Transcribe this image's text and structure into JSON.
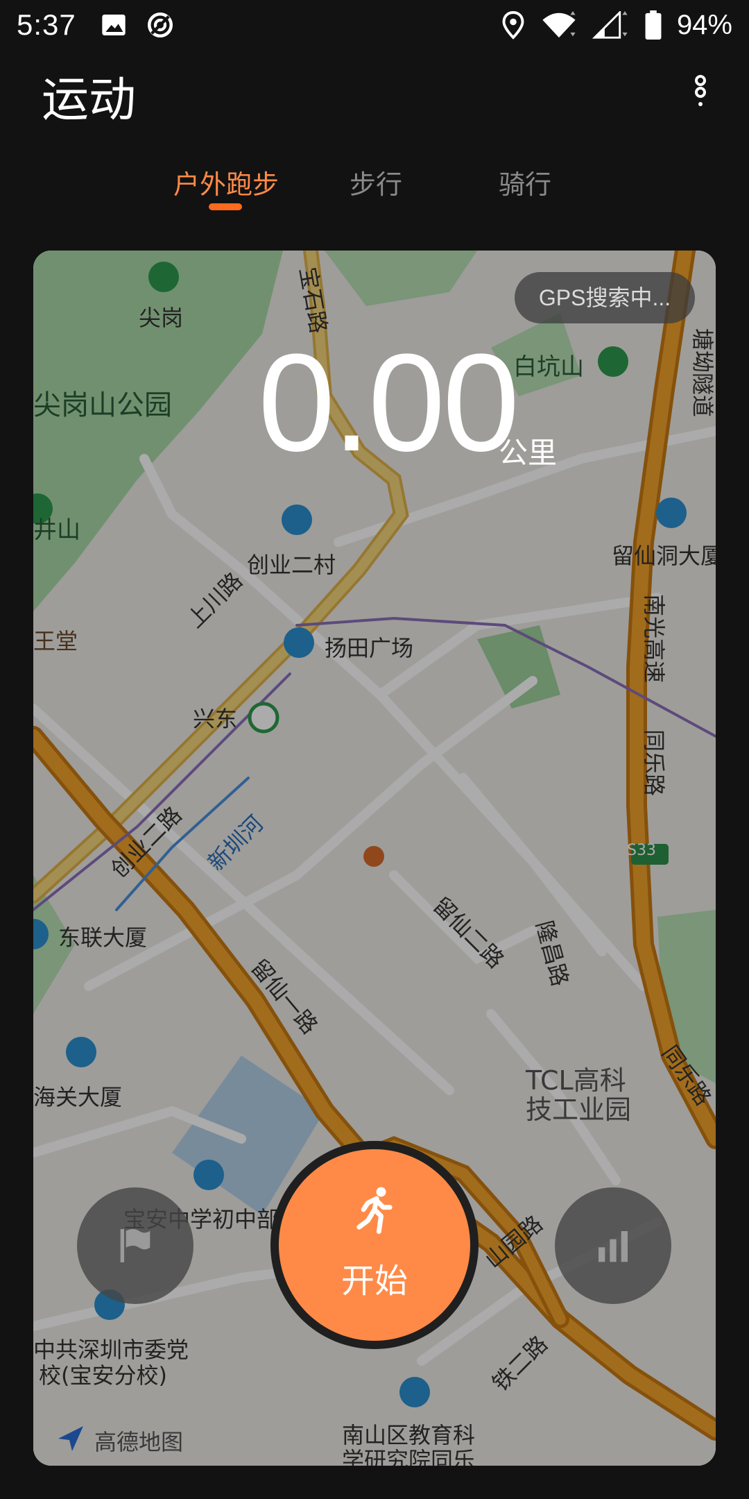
{
  "status_bar": {
    "time": "5:37",
    "battery": "94%",
    "icons": [
      "image-icon",
      "data-saver-icon",
      "location-icon",
      "wifi-icon",
      "signal-icon",
      "battery-icon"
    ]
  },
  "app_bar": {
    "title": "运动",
    "more_icon": "more-vert-icon"
  },
  "tabs": [
    {
      "label": "户外跑步",
      "active": true
    },
    {
      "label": "步行",
      "active": false
    },
    {
      "label": "骑行",
      "active": false
    }
  ],
  "colors": {
    "accent": "#ff8a47",
    "indicator": "#ff6a1e",
    "background": "#121212"
  },
  "workout": {
    "gps_status": "GPS搜索中...",
    "distance": "0.00",
    "distance_unit": "公里",
    "start_label": "开始",
    "flag_icon": "flag-icon",
    "stats_icon": "bar-chart-icon",
    "start_icon": "runner-icon"
  },
  "map": {
    "brand": "高德地图",
    "labels": [
      "尖岗",
      "尖岗山公园",
      "宝石路",
      "白坑山",
      "塘坳隧道",
      "创业二村",
      "上川路",
      "留仙洞大厦",
      "扬田广场",
      "南光高速",
      "兴东",
      "同乐路",
      "新圳河",
      "创业二路",
      "S33",
      "东联大厦",
      "留仙二路",
      "隆昌路",
      "留仙一路",
      "海关大厦",
      "TCL高科",
      "技工业园",
      "宝安中学初中部",
      "山园路",
      "中共深圳市委党",
      "校(宝安分校)",
      "铁二路",
      "南山区教育科",
      "学研究院同乐",
      "同乐路",
      "井山",
      "王堂"
    ]
  }
}
